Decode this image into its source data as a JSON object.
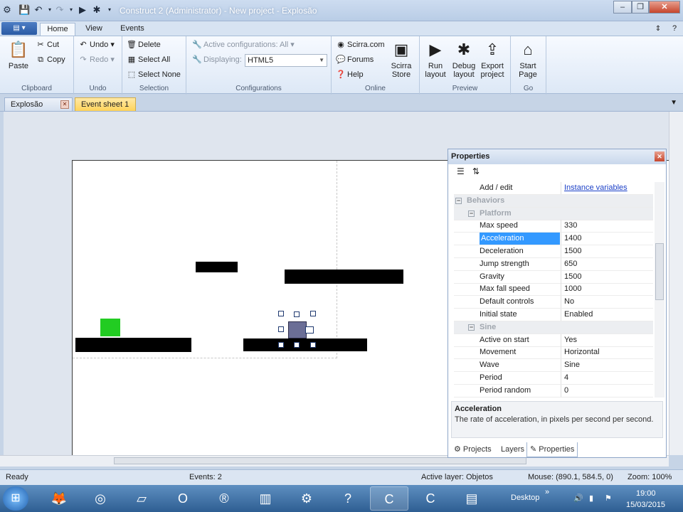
{
  "window": {
    "title": "Construct 2 (Administrator) - New project - Explosão"
  },
  "ribbon": {
    "tabs": [
      "Home",
      "View",
      "Events"
    ],
    "clipboard": {
      "paste": "Paste",
      "cut": "Cut",
      "copy": "Copy",
      "label": "Clipboard"
    },
    "undo": {
      "undo": "Undo",
      "redo": "Redo",
      "label": "Undo"
    },
    "selection": {
      "delete": "Delete",
      "select_all": "Select All",
      "select_none": "Select None",
      "label": "Selection"
    },
    "configurations": {
      "active": "Active configurations: All",
      "displaying_label": "Displaying:",
      "displaying_value": "HTML5",
      "label": "Configurations"
    },
    "online": {
      "scirra": "Scirra.com",
      "forums": "Forums",
      "help": "Help",
      "store": "Scirra Store",
      "label": "Online"
    },
    "preview": {
      "run": "Run layout",
      "debug": "Debug layout",
      "export": "Export project",
      "label": "Preview"
    },
    "go": {
      "start": "Start Page",
      "label": "Go"
    }
  },
  "doc_tabs": [
    "Explosão",
    "Event sheet 1"
  ],
  "properties": {
    "title": "Properties",
    "rows": [
      {
        "kind": "prop",
        "name": "Add / edit",
        "value": "Instance variables",
        "link": true
      },
      {
        "kind": "cat",
        "name": "Behaviors"
      },
      {
        "kind": "sub",
        "name": "Platform"
      },
      {
        "kind": "prop",
        "name": "Max speed",
        "value": "330"
      },
      {
        "kind": "prop",
        "name": "Acceleration",
        "value": "1400",
        "selected": true
      },
      {
        "kind": "prop",
        "name": "Deceleration",
        "value": "1500"
      },
      {
        "kind": "prop",
        "name": "Jump strength",
        "value": "650"
      },
      {
        "kind": "prop",
        "name": "Gravity",
        "value": "1500"
      },
      {
        "kind": "prop",
        "name": "Max fall speed",
        "value": "1000"
      },
      {
        "kind": "prop",
        "name": "Default controls",
        "value": "No"
      },
      {
        "kind": "prop",
        "name": "Initial state",
        "value": "Enabled"
      },
      {
        "kind": "sub",
        "name": "Sine"
      },
      {
        "kind": "prop",
        "name": "Active on start",
        "value": "Yes"
      },
      {
        "kind": "prop",
        "name": "Movement",
        "value": "Horizontal"
      },
      {
        "kind": "prop",
        "name": "Wave",
        "value": "Sine"
      },
      {
        "kind": "prop",
        "name": "Period",
        "value": "4"
      },
      {
        "kind": "prop",
        "name": "Period random",
        "value": "0"
      }
    ],
    "description": {
      "title": "Acceleration",
      "text": "The rate of acceleration, in pixels per second per second."
    },
    "bottom_tabs": [
      "Projects",
      "Layers",
      "Properties"
    ]
  },
  "status": {
    "ready": "Ready",
    "events": "Events: 2",
    "active_layer": "Active layer: Objetos",
    "mouse": "Mouse: (890.1, 584.5, 0)",
    "zoom": "Zoom: 100%"
  },
  "taskbar": {
    "desktop": "Desktop",
    "time": "19:00",
    "date": "15/03/2015"
  },
  "colors": {
    "player": "#22cc22",
    "platform": "#000000",
    "selection_row": "#3399ff"
  }
}
